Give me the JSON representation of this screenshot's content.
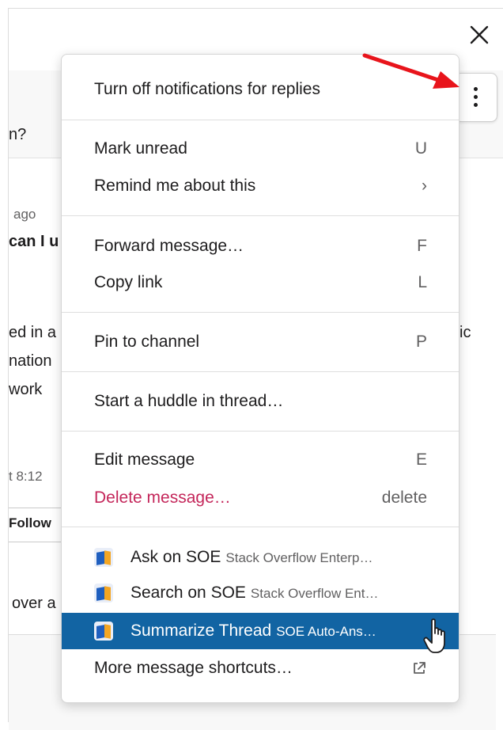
{
  "background": {
    "question_fragment": "n?",
    "time_ago": "ago",
    "bold_fragment": "can I u",
    "body_lines": [
      "ed in a",
      "nation",
      "work"
    ],
    "right_fragment": "ic",
    "time_stamp": "t 8:12",
    "follow_label": "Follow",
    "bottom_fragment": "over a"
  },
  "menu": {
    "turn_off": "Turn off notifications for replies",
    "mark_unread": {
      "label": "Mark unread",
      "shortcut": "U"
    },
    "remind": {
      "label": "Remind me about this",
      "shortcut": "›"
    },
    "forward": {
      "label": "Forward message…",
      "shortcut": "F"
    },
    "copy_link": {
      "label": "Copy link",
      "shortcut": "L"
    },
    "pin": {
      "label": "Pin to channel",
      "shortcut": "P"
    },
    "huddle": {
      "label": "Start a huddle in thread…"
    },
    "edit": {
      "label": "Edit message",
      "shortcut": "E"
    },
    "delete": {
      "label": "Delete message…",
      "shortcut": "delete"
    },
    "apps": [
      {
        "name": "Ask on SOE",
        "app": "Stack Overflow Enterp…"
      },
      {
        "name": "Search on SOE",
        "app": "Stack Overflow Ent…"
      },
      {
        "name": "Summarize Thread",
        "app": "SOE Auto-Ans…"
      }
    ],
    "more": {
      "label": "More message shortcuts…"
    }
  },
  "colors": {
    "highlight": "#1264a3",
    "danger": "#c4265a",
    "arrow": "#e8141b"
  },
  "icons": [
    "close-icon",
    "more-vertical-icon",
    "soe-app-icon",
    "external-link-icon",
    "hand-cursor-icon",
    "annotation-arrow-icon"
  ]
}
